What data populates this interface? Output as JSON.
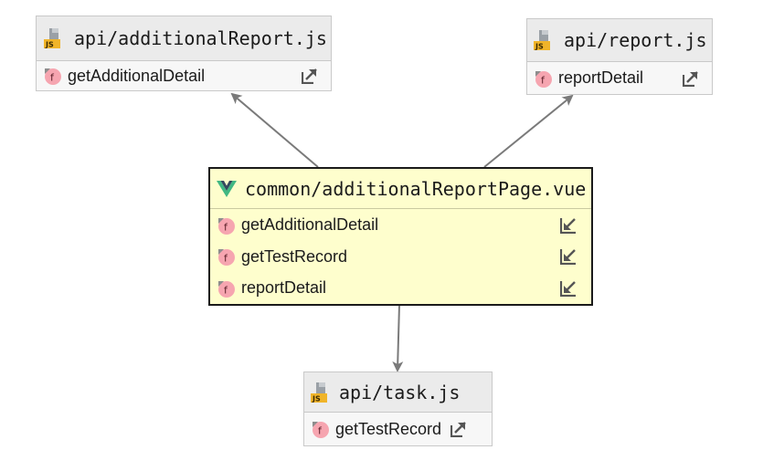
{
  "nodes": {
    "additional_report": {
      "title": "api/additionalReport.js",
      "icon": "js-file-icon",
      "functions": [
        {
          "name": "getAdditionalDetail",
          "link_icon": "navigate-out-icon"
        }
      ]
    },
    "report": {
      "title": "api/report.js",
      "icon": "js-file-icon",
      "functions": [
        {
          "name": "reportDetail",
          "link_icon": "navigate-out-icon"
        }
      ]
    },
    "page": {
      "title": "common/additionalReportPage.vue",
      "icon": "vue-file-icon",
      "functions": [
        {
          "name": "getAdditionalDetail",
          "link_icon": "navigate-in-icon"
        },
        {
          "name": "getTestRecord",
          "link_icon": "navigate-in-icon"
        },
        {
          "name": "reportDetail",
          "link_icon": "navigate-in-icon"
        }
      ]
    },
    "task": {
      "title": "api/task.js",
      "icon": "js-file-icon",
      "functions": [
        {
          "name": "getTestRecord",
          "link_icon": "navigate-out-icon"
        }
      ]
    }
  },
  "js_badge": "JS",
  "fn_badge": "f",
  "colors": {
    "center_bg": "#fefecd",
    "node_bg": "#f7f7f7",
    "header_bg": "#ebebeb",
    "arrow": "#7a7a7a",
    "fn_icon": "#f6a5b0",
    "vue_green": "#41b883",
    "vue_dark": "#35495e"
  }
}
